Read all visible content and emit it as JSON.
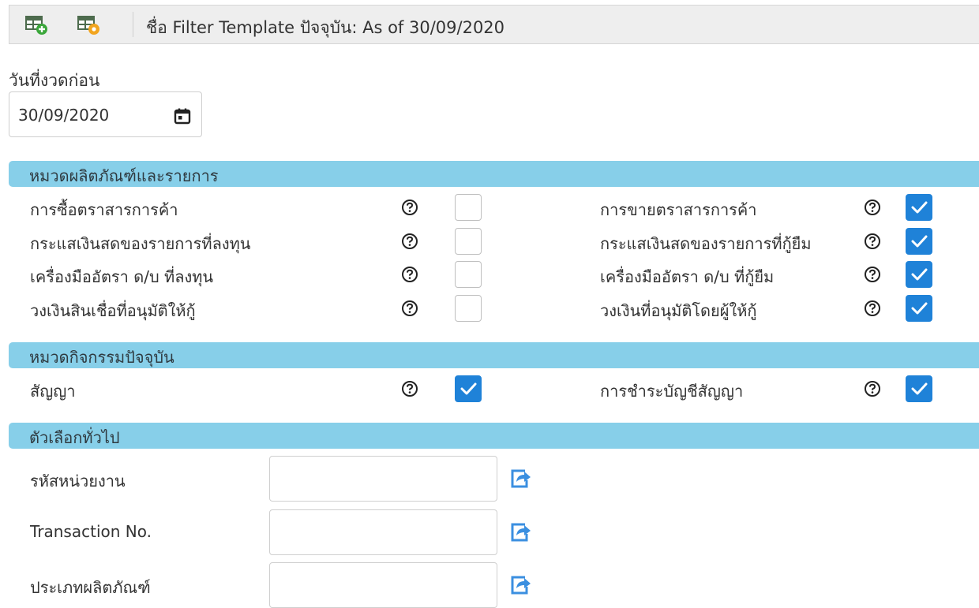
{
  "toolbar": {
    "add_icon": "table-add-icon",
    "settings_icon": "table-settings-icon",
    "title": "ชื่อ Filter Template ปัจจุบัน: As of 30/09/2020"
  },
  "date_field": {
    "label": "วันที่งวดก่อน",
    "value": "30/09/2020",
    "icon": "calendar-icon"
  },
  "sections": {
    "product": {
      "title": "หมวดผลิตภัณฑ์และรายการ",
      "left": [
        {
          "label": "การซื้อตราสารการค้า",
          "checked": false
        },
        {
          "label": "กระแสเงินสดของรายการที่ลงทุน",
          "checked": false
        },
        {
          "label": "เครื่องมืออัตรา ด/บ ที่ลงทุน",
          "checked": false
        },
        {
          "label": "วงเงินสินเชื่อที่อนุมัติให้กู้",
          "checked": false
        }
      ],
      "right": [
        {
          "label": "การขายตราสารการค้า",
          "checked": true
        },
        {
          "label": "กระแสเงินสดของรายการที่กู้ยืม",
          "checked": true
        },
        {
          "label": "เครื่องมืออัตรา ด/บ ที่กู้ยืม",
          "checked": true
        },
        {
          "label": "วงเงินที่อนุมัติโดยผู้ให้กู้",
          "checked": true
        }
      ]
    },
    "activity": {
      "title": "หมวดกิจกรรมปัจจุบัน",
      "left": [
        {
          "label": "สัญญา",
          "checked": true
        }
      ],
      "right": [
        {
          "label": "การชำระบัญชีสัญญา",
          "checked": true
        }
      ]
    },
    "general": {
      "title": "ตัวเลือกทั่วไป",
      "fields": [
        {
          "label": "รหัสหน่วยงาน",
          "value": ""
        },
        {
          "label": "Transaction No.",
          "value": ""
        },
        {
          "label": "ประเภทผลิตภัณฑ์",
          "value": ""
        }
      ]
    }
  },
  "colors": {
    "section_bar": "#87cfe9",
    "checkbox_checked": "#1f82d8",
    "share_icon": "#3b8fe0",
    "toolbar_bg": "#eeeeee"
  }
}
